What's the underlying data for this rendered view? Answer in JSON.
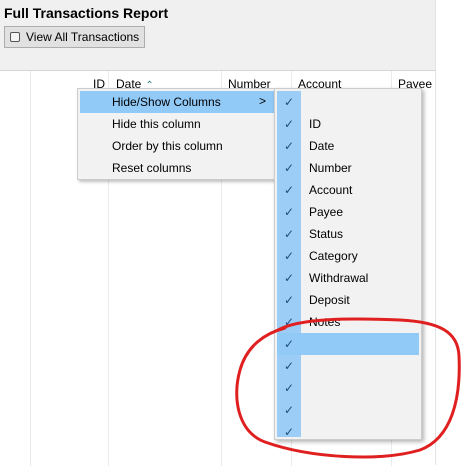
{
  "report": {
    "title": "Full Transactions Report",
    "view_all_button": "View All Transactions"
  },
  "grid": {
    "headers": [
      {
        "key": "id",
        "label": "ID"
      },
      {
        "key": "date",
        "label": "Date",
        "sort": "ascending"
      },
      {
        "key": "number",
        "label": "Number"
      },
      {
        "key": "account",
        "label": "Account"
      },
      {
        "key": "payee",
        "label": "Payee"
      }
    ],
    "sort_icon": "chevron-up-icon"
  },
  "context_menu": {
    "items": [
      {
        "label": "Hide/Show Columns",
        "has_submenu": true,
        "active": true
      },
      {
        "label": "Hide this column"
      },
      {
        "label": "Order by this column"
      },
      {
        "label": "Reset columns"
      }
    ],
    "submenu_arrow": ">"
  },
  "columns_submenu": {
    "items": [
      {
        "label": "",
        "checked": true
      },
      {
        "label": "ID",
        "checked": true
      },
      {
        "label": "Date",
        "checked": true
      },
      {
        "label": "Number",
        "checked": true
      },
      {
        "label": "Account",
        "checked": true
      },
      {
        "label": "Payee",
        "checked": true
      },
      {
        "label": "Status",
        "checked": true
      },
      {
        "label": "Category",
        "checked": true
      },
      {
        "label": "Withdrawal",
        "checked": true
      },
      {
        "label": "Deposit",
        "checked": true
      },
      {
        "label": "Notes",
        "checked": true
      },
      {
        "label": "",
        "checked": true,
        "highlighted": true
      },
      {
        "label": "",
        "checked": true
      },
      {
        "label": "",
        "checked": true
      },
      {
        "label": "",
        "checked": true
      },
      {
        "label": "",
        "checked": true
      }
    ],
    "check_glyph": "✓"
  },
  "colors": {
    "highlight": "#91c9f7",
    "check_strip": "#9ccdf6",
    "annotation": "#e02020"
  }
}
